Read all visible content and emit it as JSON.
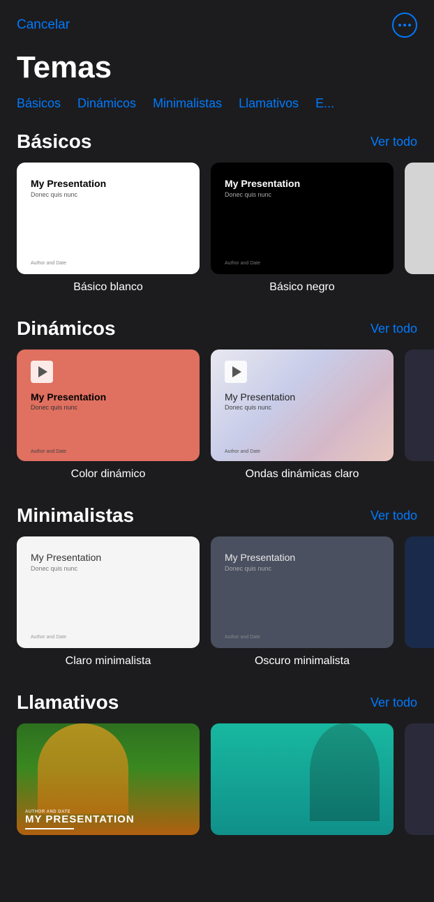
{
  "header": {
    "cancel_label": "Cancelar",
    "more_button_label": "Más opciones"
  },
  "page": {
    "title": "Temas"
  },
  "tabs": [
    {
      "id": "basicos",
      "label": "Básicos"
    },
    {
      "id": "dinamicos",
      "label": "Dinámicos"
    },
    {
      "id": "minimalistas",
      "label": "Minimalistas"
    },
    {
      "id": "llamativos",
      "label": "Llamativos"
    },
    {
      "id": "otros",
      "label": "E..."
    }
  ],
  "sections": [
    {
      "id": "basicos",
      "title": "Básicos",
      "see_all_label": "Ver todo",
      "templates": [
        {
          "id": "basico-blanco",
          "label": "Básico blanco",
          "style": "basic-white",
          "title_text": "My Presentation",
          "sub_text": "Donec quis nunc",
          "author_text": "Author and Date"
        },
        {
          "id": "basico-negro",
          "label": "Básico negro",
          "style": "basic-black",
          "title_text": "My Presentation",
          "sub_text": "Donec quis nunc",
          "author_text": "Author and Date"
        }
      ]
    },
    {
      "id": "dinamicos",
      "title": "Dinámicos",
      "see_all_label": "Ver todo",
      "templates": [
        {
          "id": "color-dinamico",
          "label": "Color dinámico",
          "style": "dynamic-color",
          "title_text": "My Presentation",
          "sub_text": "Donec quis nunc",
          "author_text": "Author and Date"
        },
        {
          "id": "ondas-dinamicas-claro",
          "label": "Ondas dinámicas claro",
          "style": "dynamic-waves",
          "title_text": "My Presentation",
          "sub_text": "Donec quis nunc",
          "author_text": "Author and Date"
        }
      ]
    },
    {
      "id": "minimalistas",
      "title": "Minimalistas",
      "see_all_label": "Ver todo",
      "templates": [
        {
          "id": "claro-minimalista",
          "label": "Claro minimalista",
          "style": "minimal-light",
          "title_text": "My Presentation",
          "sub_text": "Donec quis nunc",
          "author_text": "Author and Date"
        },
        {
          "id": "oscuro-minimalista",
          "label": "Oscuro minimalista",
          "style": "minimal-dark",
          "title_text": "My Presentation",
          "sub_text": "Donec quis nunc",
          "author_text": "Author and Date"
        }
      ]
    },
    {
      "id": "llamativos",
      "title": "Llamativos",
      "see_all_label": "Ver todo",
      "templates": [
        {
          "id": "llamativo-1",
          "label": "",
          "style": "llamativo-1",
          "author_text": "AUTHOR AND DATE",
          "title_text": "MY PRESENTATION"
        },
        {
          "id": "llamativo-2",
          "label": "",
          "style": "llamativo-2"
        }
      ]
    }
  ]
}
